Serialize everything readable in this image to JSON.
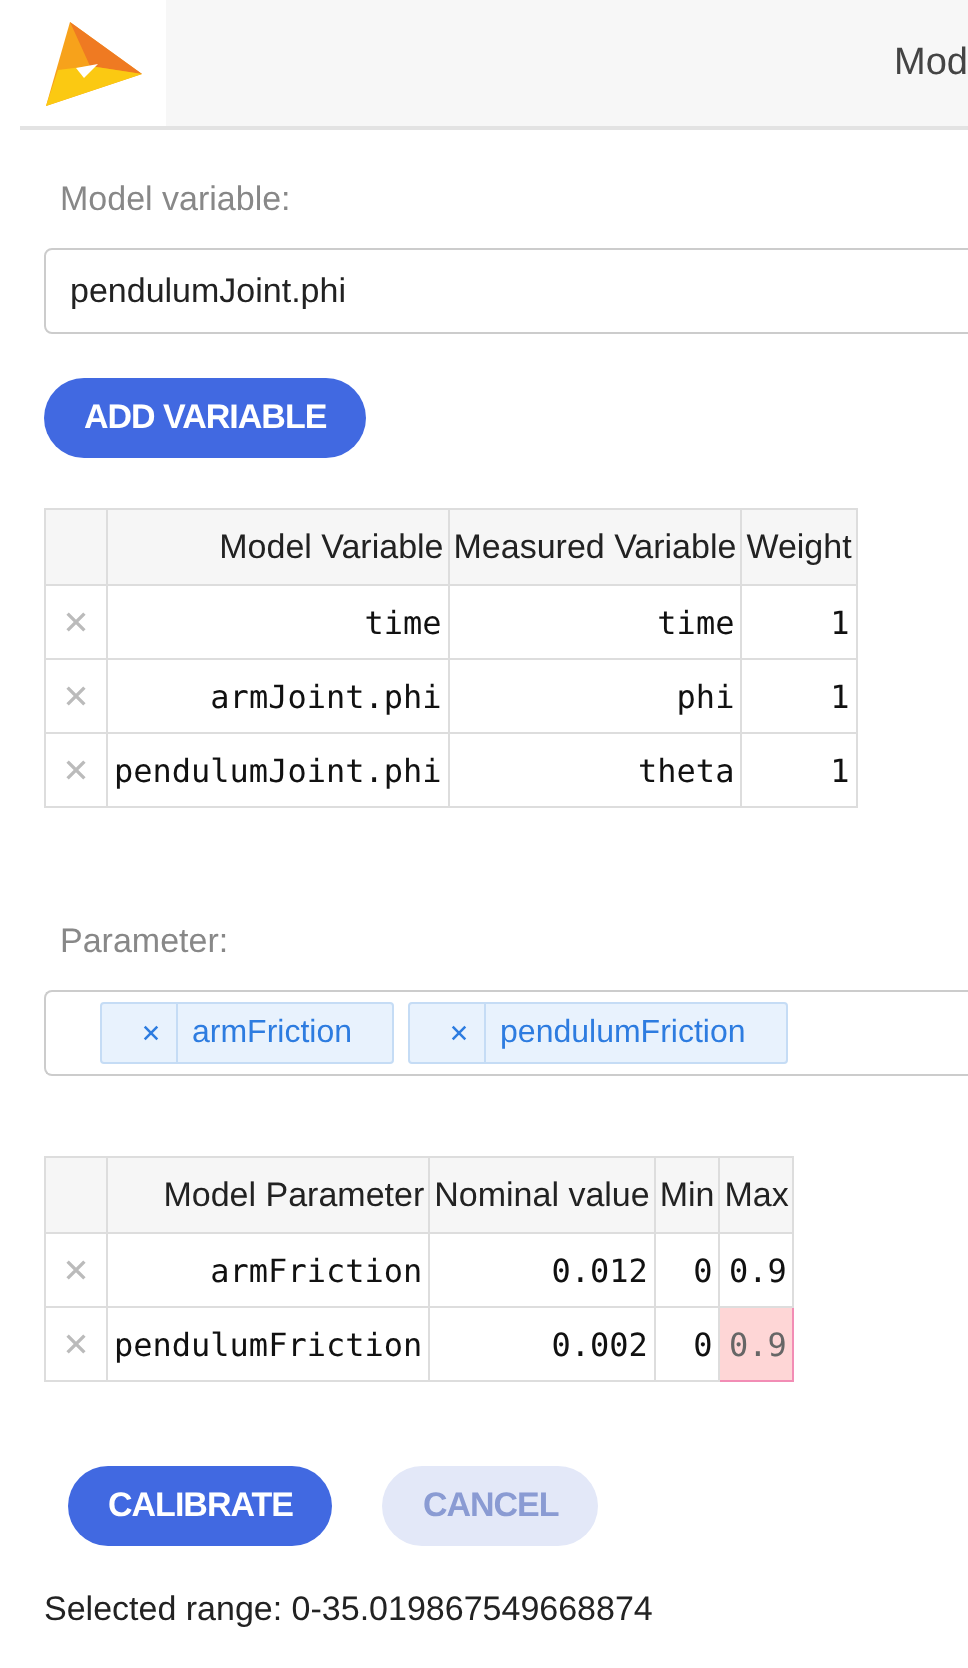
{
  "header": {
    "title": "Mod"
  },
  "variable_section": {
    "label": "Model variable:",
    "input": {
      "value": "pendulumJoint.phi"
    },
    "button": {
      "label": "ADD VARIABLE",
      "disabled": false
    }
  },
  "variables_table": {
    "columns": [
      "Model Variable",
      "Measured Variable",
      "Weight"
    ],
    "rows": [
      {
        "cells": [
          {
            "text": "time",
            "invalid": false
          },
          {
            "text": "time",
            "invalid": false
          },
          {
            "text": "1",
            "invalid": false
          }
        ]
      },
      {
        "cells": [
          {
            "text": "armJoint.phi",
            "invalid": false
          },
          {
            "text": "phi",
            "invalid": false
          },
          {
            "text": "1",
            "invalid": false
          }
        ]
      },
      {
        "cells": [
          {
            "text": "pendulumJoint.phi",
            "invalid": false
          },
          {
            "text": "theta",
            "invalid": false
          },
          {
            "text": "1",
            "invalid": false
          }
        ]
      }
    ]
  },
  "parameter_section": {
    "label": "Parameter:",
    "tags": [
      {
        "label": "armFriction"
      },
      {
        "label": "pendulumFriction"
      }
    ]
  },
  "parameters_table": {
    "columns": [
      "Model Parameter",
      "Nominal value",
      "Min",
      "Max"
    ],
    "rows": [
      {
        "cells": [
          {
            "text": "armFriction",
            "invalid": false
          },
          {
            "text": "0.012",
            "invalid": false
          },
          {
            "text": "0",
            "invalid": false
          },
          {
            "text": "0.9",
            "invalid": false
          }
        ]
      },
      {
        "cells": [
          {
            "text": "pendulumFriction",
            "invalid": false
          },
          {
            "text": "0.002",
            "invalid": false
          },
          {
            "text": "0",
            "invalid": false
          },
          {
            "text": "0.9",
            "invalid": true
          }
        ]
      }
    ]
  },
  "actions": [
    {
      "label": "CALIBRATE",
      "disabled": false
    },
    {
      "label": "CANCEL",
      "disabled": true
    }
  ],
  "status": "Selected range: 0-35.019867549668874"
}
